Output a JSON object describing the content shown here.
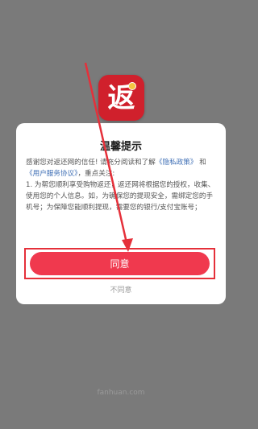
{
  "app_icon": {
    "glyph": "返",
    "name": "app-logo"
  },
  "dialog": {
    "title": "温馨提示",
    "intro": "感谢您对返还网的信任! 请充分阅读和了解",
    "privacy_link": "《隐私政策》",
    "and_text": "和",
    "service_link": "《用户服务协议》",
    "intro_tail": "，重点关注:",
    "clause_1": "1. 为帮您顺利享受购物返还，返还网将根据您的授权，收集、使用您的个人信息。如，为确保您的提现安全，需绑定您的手机号；为保障您能顺利提现，需要您的银行/支付宝账号；",
    "agree_label": "同意",
    "disagree_label": "不同意"
  },
  "watermark": "fanhuan.com",
  "colors": {
    "primary": "#f0394e",
    "link": "#3f6fb5",
    "highlight": "#e5303a"
  }
}
